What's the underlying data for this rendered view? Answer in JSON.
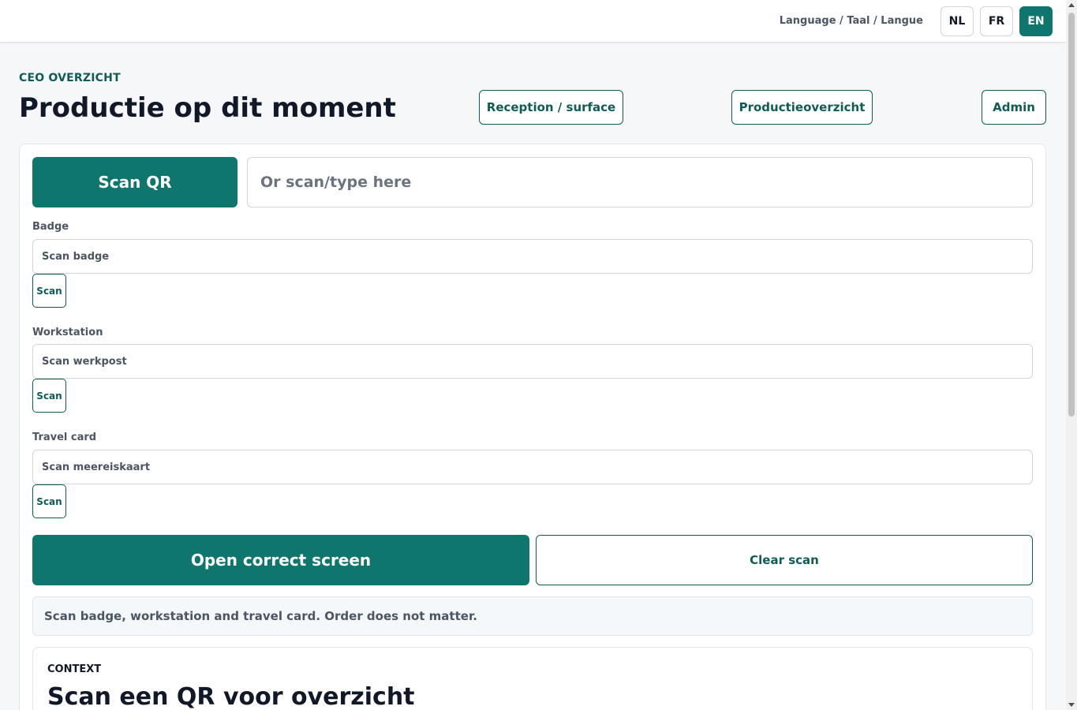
{
  "topbar": {
    "language_label": "Language / Taal / Langue",
    "languages": [
      "NL",
      "FR",
      "EN"
    ],
    "active_language": "EN"
  },
  "header": {
    "eyebrow": "CEO OVERZICHT",
    "title": "Productie op dit moment",
    "nav": [
      "Reception / surface",
      "Productieoverzicht",
      "Admin"
    ]
  },
  "scanner": {
    "scan_qr_label": "Scan QR",
    "input_placeholder": "Or scan/type here",
    "fields": [
      {
        "label": "Badge",
        "placeholder": "Scan badge",
        "button": "Scan"
      },
      {
        "label": "Workstation",
        "placeholder": "Scan werkpost",
        "button": "Scan"
      },
      {
        "label": "Travel card",
        "placeholder": "Scan meereiskaart",
        "button": "Scan"
      }
    ],
    "open_label": "Open correct screen",
    "clear_label": "Clear scan",
    "hint": "Scan badge, workstation and travel card. Order does not matter."
  },
  "context": {
    "eyebrow": "CONTEXT",
    "title": "Scan een QR voor overzicht"
  },
  "colors": {
    "accent": "#0f766e",
    "accent_dark": "#0f5c57",
    "background": "#f5f7f9"
  }
}
